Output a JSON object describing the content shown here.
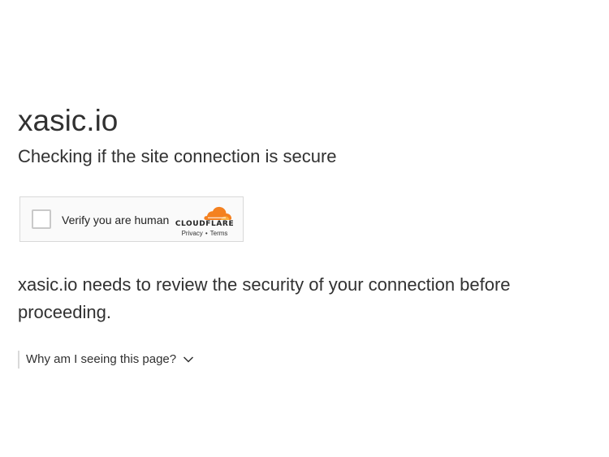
{
  "site_name": "xasic.io",
  "subtitle": "Checking if the site connection is secure",
  "widget": {
    "verify_label": "Verify you are human",
    "brand_name": "CLOUDFLARE",
    "privacy_label": "Privacy",
    "separator": "•",
    "terms_label": "Terms",
    "brand_color": "#f48120"
  },
  "message": "xasic.io needs to review the security of your connection before proceeding.",
  "why_label": "Why am I seeing this page?",
  "icons": {
    "chevron": "chevron-down-icon",
    "logo": "cloudflare-logo"
  }
}
